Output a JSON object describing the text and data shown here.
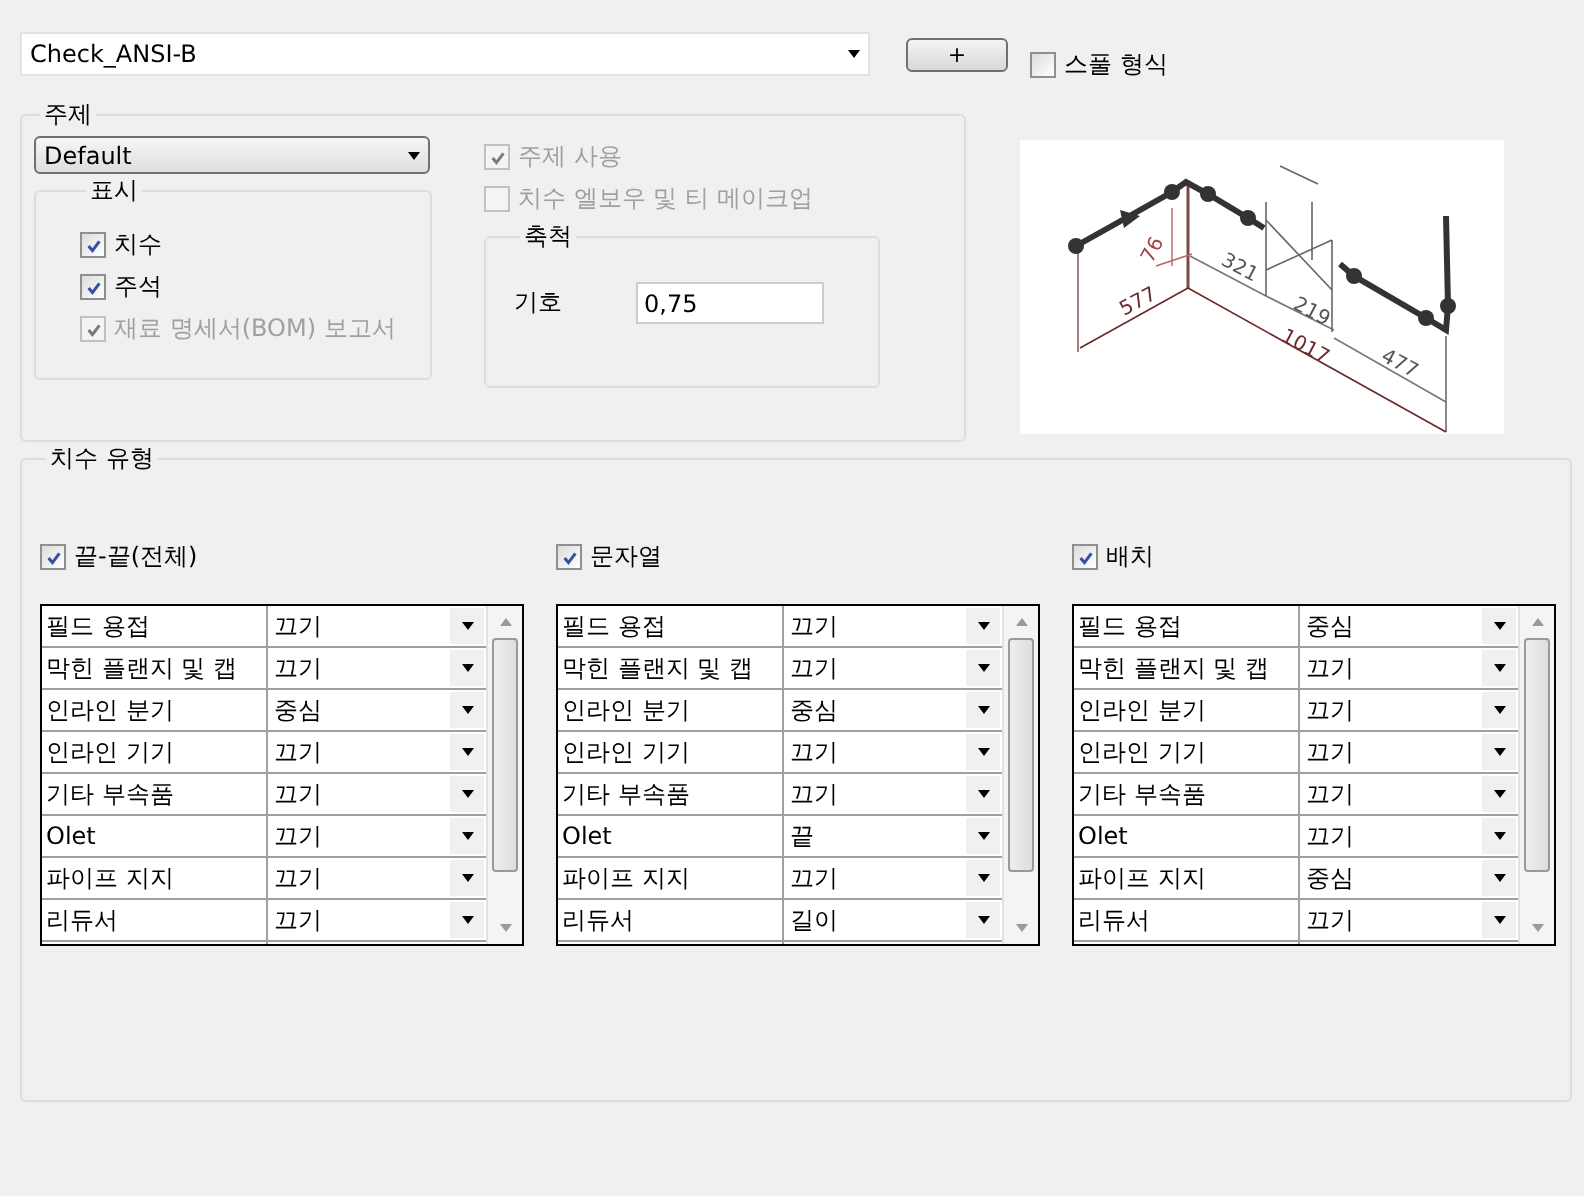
{
  "style_combo": {
    "value": "Check_ANSI-B"
  },
  "add_button": {
    "label": "+"
  },
  "spool_format": {
    "label": "스풀 형식",
    "checked": false
  },
  "theme_group": {
    "title": "주제",
    "combo": {
      "value": "Default"
    },
    "options": [
      {
        "label": "주제 사용",
        "checked": true,
        "disabled": true
      },
      {
        "label": "치수 엘보우 및 티 메이크업",
        "checked": false,
        "disabled": true
      }
    ],
    "display_group": {
      "title": "표시",
      "items": [
        {
          "label": "치수",
          "checked": true,
          "disabled": false
        },
        {
          "label": "주석",
          "checked": true,
          "disabled": false
        },
        {
          "label": "재료 명세서(BOM) 보고서",
          "checked": true,
          "disabled": true
        }
      ]
    },
    "scale_group": {
      "title": "축척",
      "label": "기호",
      "value": "0,75"
    }
  },
  "preview": {
    "dimension_labels": [
      "76",
      "321",
      "577",
      "219",
      "1017",
      "477"
    ]
  },
  "dimension_types": {
    "title": "치수 유형",
    "columns": [
      {
        "label": "끝-끝(전체)",
        "checked": true,
        "rows": [
          {
            "name": "필드 용접",
            "value": "끄기"
          },
          {
            "name": "막힌 플랜지 및 캡",
            "value": "끄기"
          },
          {
            "name": "인라인 분기",
            "value": "중심"
          },
          {
            "name": "인라인 기기",
            "value": "끄기"
          },
          {
            "name": "기타 부속품",
            "value": "끄기"
          },
          {
            "name": "Olet",
            "value": "끄기"
          },
          {
            "name": "파이프 지지",
            "value": "끄기"
          },
          {
            "name": "리듀서",
            "value": "끄기"
          }
        ]
      },
      {
        "label": "문자열",
        "checked": true,
        "rows": [
          {
            "name": "필드 용접",
            "value": "끄기"
          },
          {
            "name": "막힌 플랜지 및 캡",
            "value": "끄기"
          },
          {
            "name": "인라인 분기",
            "value": "중심"
          },
          {
            "name": "인라인 기기",
            "value": "끄기"
          },
          {
            "name": "기타 부속품",
            "value": "끄기"
          },
          {
            "name": "Olet",
            "value": "끝"
          },
          {
            "name": "파이프 지지",
            "value": "끄기"
          },
          {
            "name": "리듀서",
            "value": "길이"
          }
        ]
      },
      {
        "label": "배치",
        "checked": true,
        "rows": [
          {
            "name": "필드 용접",
            "value": "중심"
          },
          {
            "name": "막힌 플랜지 및 캡",
            "value": "끄기"
          },
          {
            "name": "인라인 분기",
            "value": "끄기"
          },
          {
            "name": "인라인 기기",
            "value": "끄기"
          },
          {
            "name": "기타 부속품",
            "value": "끄기"
          },
          {
            "name": "Olet",
            "value": "끄기"
          },
          {
            "name": "파이프 지지",
            "value": "중심"
          },
          {
            "name": "리듀서",
            "value": "끄기"
          }
        ]
      }
    ]
  }
}
